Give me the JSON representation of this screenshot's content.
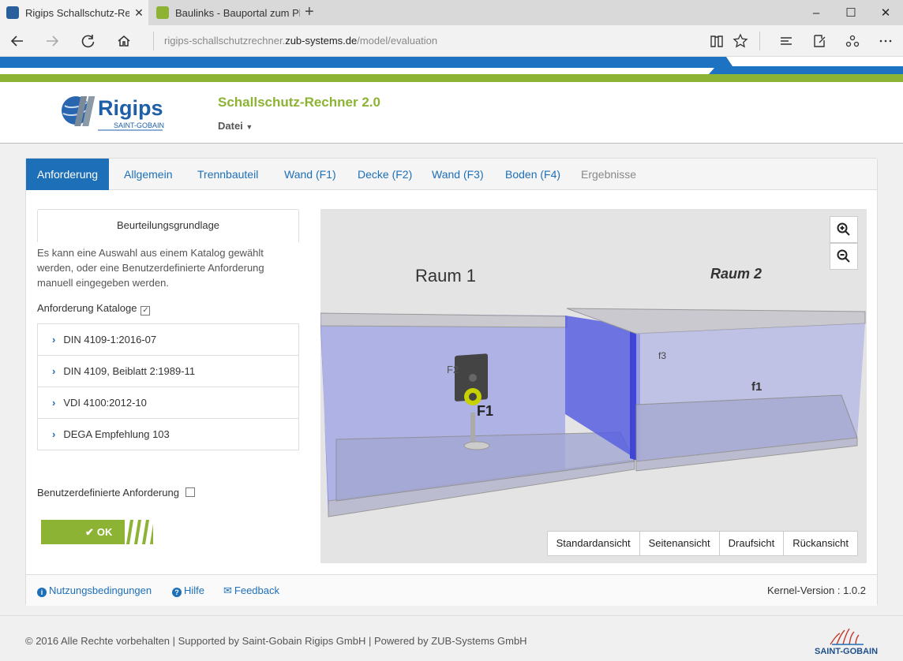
{
  "browser": {
    "tabs": [
      {
        "title": "Rigips Schallschutz-Rec",
        "close": "✕"
      },
      {
        "title": "Baulinks - Bauportal zum Pl",
        "close": ""
      }
    ],
    "new_tab": "+",
    "window_controls": {
      "minimize": "–",
      "maximize": "☐",
      "close": "✕"
    },
    "url_prefix": "rigips-schallschutzrechner.",
    "url_domain": "zub-systems.de",
    "url_path": "/model/evaluation"
  },
  "header": {
    "logo_text": "Rigips",
    "logo_sub": "SAINT-GOBAIN",
    "app_title": "Schallschutz-Rechner 2.0",
    "menu_datei": "Datei"
  },
  "tabs": [
    {
      "label": "Anforderung",
      "state": "active"
    },
    {
      "label": "Allgemein",
      "state": "normal"
    },
    {
      "label": "Trennbauteil",
      "state": "normal"
    },
    {
      "label": "Wand (F1)",
      "state": "normal"
    },
    {
      "label": "Decke (F2)",
      "state": "normal"
    },
    {
      "label": "Wand (F3)",
      "state": "normal"
    },
    {
      "label": "Boden (F4)",
      "state": "normal"
    },
    {
      "label": "Ergebnisse",
      "state": "disabled"
    }
  ],
  "left": {
    "section_title": "Beurteilungsgrundlage",
    "description": "Es kann eine Auswahl aus einem Katalog gewählt werden, oder eine Benutzerdefinierte Anforderung manuell eingegeben werden.",
    "katalog_label": "Anforderung Kataloge",
    "katalog_checked": true,
    "catalog_items": [
      "DIN 4109-1:2016-07",
      "DIN 4109, Beiblatt 2:1989-11",
      "VDI 4100:2012-10",
      "DEGA Empfehlung 103"
    ],
    "custom_label": "Benutzerdefinierte Anforderung",
    "custom_checked": false,
    "ok_label": "OK"
  },
  "viewer": {
    "room1": "Raum 1",
    "room2": "Raum 2",
    "labels": {
      "f1_left": "F1",
      "f2": "F2",
      "f3": "f3",
      "f1_right": "f1"
    },
    "view_buttons": [
      "Standardansicht",
      "Seitenansicht",
      "Draufsicht",
      "Rückansicht"
    ]
  },
  "footer": {
    "links": [
      "Nutzungsbedingungen",
      "Hilfe",
      "Feedback"
    ],
    "kernel_version": "Kernel-Version : 1.0.2"
  },
  "page_footer": {
    "copyright": "© 2016 Alle Rechte vorbehalten | Supported by Saint-Gobain Rigips GmbH | Powered by ZUB-Systems GmbH",
    "brand": "SAINT-GOBAIN"
  },
  "colors": {
    "accent_blue": "#1d6fb8",
    "accent_green": "#8cb333",
    "room_fill": "#8a8fd8"
  }
}
